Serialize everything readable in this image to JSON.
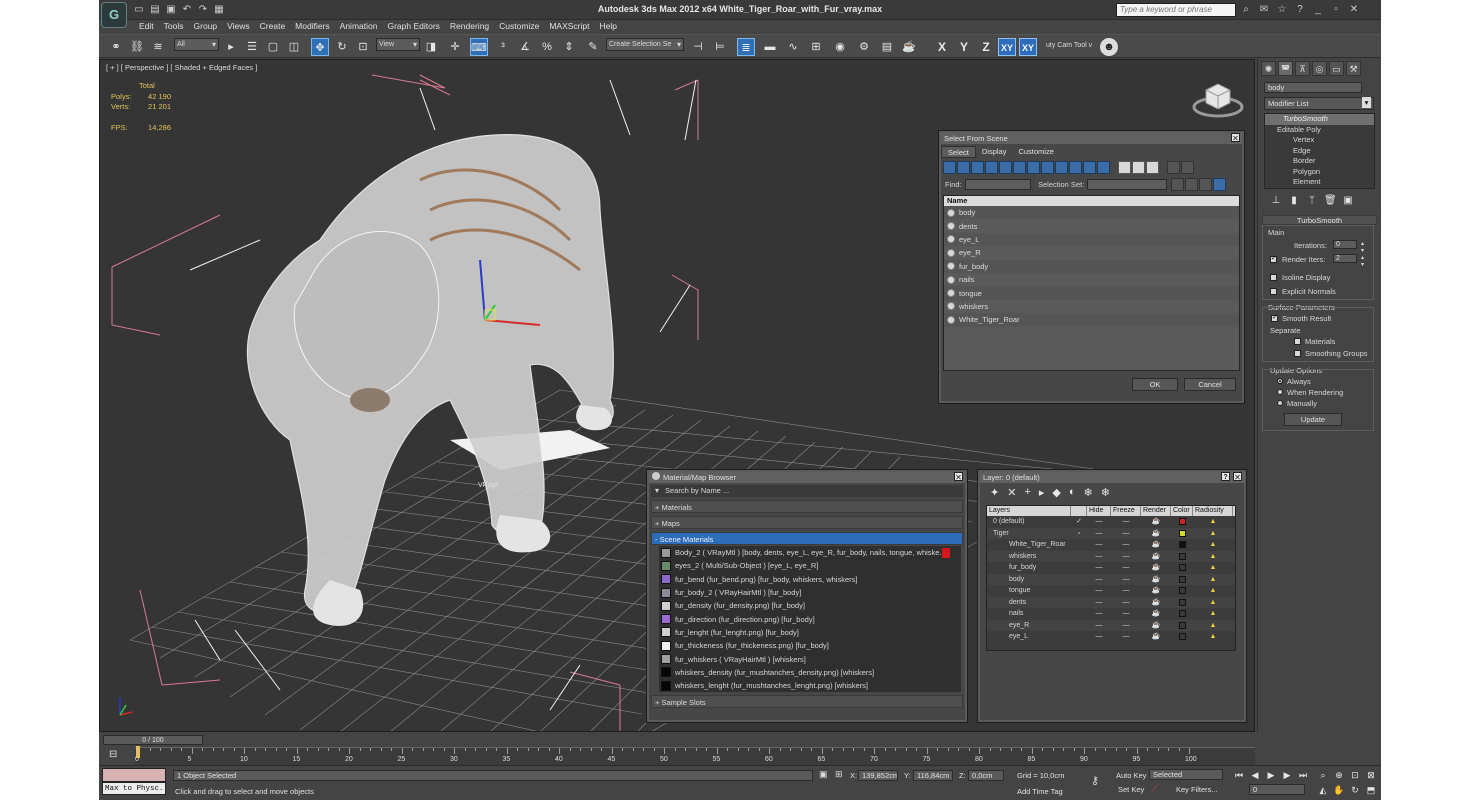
{
  "app": {
    "title": "Autodesk 3ds Max  2012 x64     White_Tiger_Roar_with_Fur_vray.max",
    "logo": "3ds-max-logo",
    "search_placeholder": "Type a keyword or phrase",
    "menu": [
      "Edit",
      "Tools",
      "Group",
      "Views",
      "Create",
      "Modifiers",
      "Animation",
      "Graph Editors",
      "Rendering",
      "Customize",
      "MAXScript",
      "Help"
    ]
  },
  "toolbar": {
    "filter": "All",
    "ref_coord": "View",
    "selection_set": "Create Selection Se",
    "axes": [
      "X",
      "Y",
      "Z",
      "XY",
      "XY"
    ],
    "cam_tool": "uty Cam Tool v"
  },
  "viewport": {
    "label": "[ + ] [ Perspective ] [ Shaded + Edged Faces ]",
    "stats_header": "Total",
    "stats": [
      {
        "label": "Polys:",
        "value": "42 190"
      },
      {
        "label": "Verts:",
        "value": "21 201"
      }
    ],
    "fps_label": "FPS:",
    "fps_value": "14,286",
    "object_label": "VRayF"
  },
  "select_from_scene": {
    "title": "Select From Scene",
    "menu": [
      "Select",
      "Display",
      "Customize"
    ],
    "find_label": "Find:",
    "selection_set_label": "Selection Set:",
    "column": "Name",
    "items": [
      "body",
      "dents",
      "eye_L",
      "eye_R",
      "fur_body",
      "nails",
      "tongue",
      "whiskers",
      "White_Tiger_Roar"
    ],
    "ok": "OK",
    "cancel": "Cancel"
  },
  "material_browser": {
    "title": "Material/Map Browser",
    "search": "Search by Name ...",
    "rollouts": [
      "+ Materials",
      "+ Maps",
      "- Scene Materials",
      "+ Sample Slots"
    ],
    "materials": [
      {
        "name": "Body_2  ( VRayMtl ) [body, dents, eye_L, eye_R, fur_body, nails, tongue, whiske...",
        "swatch": "#9a9a9a"
      },
      {
        "name": "eyes_2  ( Multi/Sub-Object ) [eye_L, eye_R]",
        "swatch": "#6a8a6a"
      },
      {
        "name": "fur_bend (fur_bend.png) [fur_body, whiskers, whiskers]",
        "swatch": "#8a6ac8"
      },
      {
        "name": "fur_body_2  ( VRayHairMtl ) [fur_body]",
        "swatch": "#8a8a9a"
      },
      {
        "name": "fur_density (fur_density.png) [fur_body]",
        "swatch": "#cfcfcf"
      },
      {
        "name": "fur_direction (fur_direction.png) [fur_body]",
        "swatch": "#9a6ad0"
      },
      {
        "name": "fur_lenght (fur_lenght.png) [fur_body]",
        "swatch": "#d0d0d0"
      },
      {
        "name": "fur_thickeness (fur_thickeness.png) [fur_body]",
        "swatch": "#f2f2f2"
      },
      {
        "name": "fur_whiskers  ( VRayHairMtl ) [whiskers]",
        "swatch": "#a0a0a0"
      },
      {
        "name": "whiskers_density (fur_mushtanches_density.png) [whiskers]",
        "swatch": "#050505"
      },
      {
        "name": "whiskers_lenght (fur_mushtanches_lenght.png) [whiskers]",
        "swatch": "#050505"
      }
    ]
  },
  "layer_manager": {
    "title": "Layer: 0 (default)",
    "columns": [
      "Layers",
      "Hide",
      "Freeze",
      "Render",
      "Color",
      "Radiosity"
    ],
    "rows": [
      {
        "name": "0 (default)",
        "indent": 1,
        "color": "#cc2222"
      },
      {
        "name": "Tiger",
        "indent": 1,
        "color": "#d8d82a"
      },
      {
        "name": "White_Tiger_Roar",
        "indent": 2,
        "color": "#111111"
      },
      {
        "name": "whiskers",
        "indent": 2,
        "color": "#3a3a3a"
      },
      {
        "name": "fur_body",
        "indent": 2,
        "color": "#3a3a3a"
      },
      {
        "name": "body",
        "indent": 2,
        "color": "#3a3a3a"
      },
      {
        "name": "tongue",
        "indent": 2,
        "color": "#3a3a3a"
      },
      {
        "name": "dents",
        "indent": 2,
        "color": "#3a3a3a"
      },
      {
        "name": "nails",
        "indent": 2,
        "color": "#3a3a3a"
      },
      {
        "name": "eye_R",
        "indent": 2,
        "color": "#3a3a3a"
      },
      {
        "name": "eye_L",
        "indent": 2,
        "color": "#3a3a3a"
      }
    ]
  },
  "command_panel": {
    "object_name": "body",
    "modifier_list": "Modifier List",
    "stack": {
      "top": "TurboSmooth",
      "base": "Editable Poly",
      "subs": [
        "Vertex",
        "Edge",
        "Border",
        "Polygon",
        "Element"
      ]
    },
    "rollout": "TurboSmooth",
    "main": "Main",
    "iterations_label": "Iterations:",
    "iterations": "0",
    "render_iters_label": "Render Iters:",
    "render_iters": "2",
    "isoline": "Isoline Display",
    "explicit_normals": "Explicit Normals",
    "surface_params": "Surface Parameters",
    "smooth_result": "Smooth Result",
    "separate": "Separate",
    "materials": "Materials",
    "smoothing_groups": "Smoothing Groups",
    "update_options": "Update Options",
    "always": "Always",
    "when_rendering": "When Rendering",
    "manually": "Manually",
    "update": "Update"
  },
  "timeline": {
    "slider": "0 / 100",
    "ticks": [
      "0",
      "5",
      "10",
      "15",
      "20",
      "25",
      "30",
      "35",
      "40",
      "45",
      "50",
      "55",
      "60",
      "65",
      "70",
      "75",
      "80",
      "85",
      "90",
      "95",
      "100"
    ]
  },
  "status": {
    "maxscript": "Max to Physc.",
    "selected": "1 Object Selected",
    "prompt": "Click and drag to select and move objects",
    "x_label": "X:",
    "x": "139,852cm",
    "y_label": "Y:",
    "y": "116,84cm",
    "z_label": "Z:",
    "z": "0,0cm",
    "grid": "Grid = 10,0cm",
    "add_time_tag": "Add Time Tag",
    "auto_key": "Auto Key",
    "set_key": "Set Key",
    "selected_dd": "Selected",
    "key_filters": "Key Filters...",
    "frame": "0"
  }
}
